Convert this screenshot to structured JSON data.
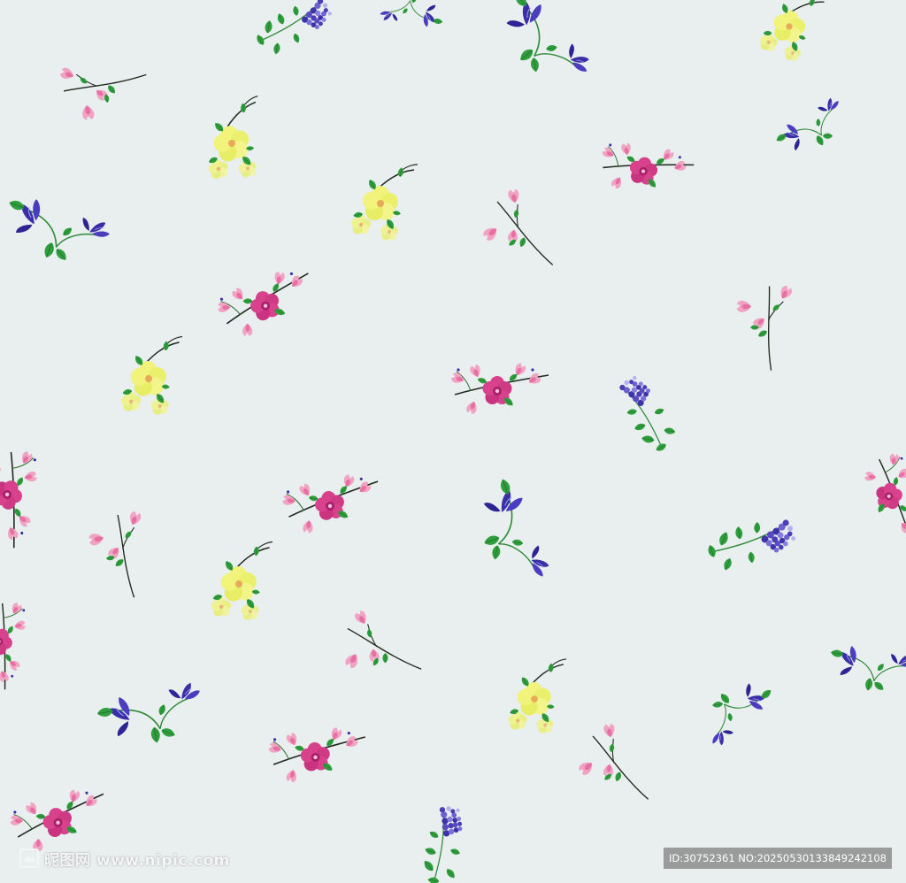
{
  "image": {
    "kind": "seamless floral textile pattern",
    "background_color": "#e9eeee",
    "motif_colors": {
      "pink": "#d43c8a",
      "light_pink": "#f0a5c4",
      "yellow": "#eef06a",
      "blue": "#3a2fa8",
      "lavender": "#6a5cc4",
      "green": "#2e9a3a",
      "stem": "#1e2a1e"
    }
  },
  "watermark": {
    "left_text": "昵图网 www.nipic.com",
    "right_text": "ID:30752361 NO:20250530133849242108"
  }
}
